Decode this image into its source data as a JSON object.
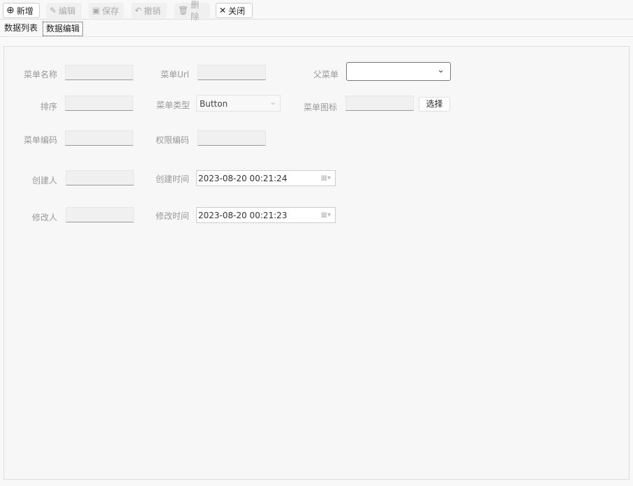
{
  "toolbar": {
    "add": "新增",
    "edit": "编辑",
    "save": "保存",
    "undo": "撤销",
    "delete": "删除",
    "close": "关闭"
  },
  "tabs": {
    "list": "数据列表",
    "edit": "数据编辑"
  },
  "form": {
    "menu_name": {
      "label": "菜单名称",
      "value": ""
    },
    "menu_url": {
      "label": "菜单Url",
      "value": ""
    },
    "parent_menu": {
      "label": "父菜单",
      "value": ""
    },
    "sort": {
      "label": "排序",
      "value": ""
    },
    "menu_type": {
      "label": "菜单类型",
      "value": "Button"
    },
    "menu_icon": {
      "label": "菜单图标",
      "value": "",
      "select_label": "选择"
    },
    "menu_code": {
      "label": "菜单编码",
      "value": ""
    },
    "perm_code": {
      "label": "权限编码",
      "value": ""
    },
    "creator": {
      "label": "创建人",
      "value": ""
    },
    "create_time": {
      "label": "创建时间",
      "value": "2023-08-20 00:21:24"
    },
    "modifier": {
      "label": "修改人",
      "value": ""
    },
    "modify_time": {
      "label": "修改时间",
      "value": "2023-08-20 00:21:23"
    }
  }
}
